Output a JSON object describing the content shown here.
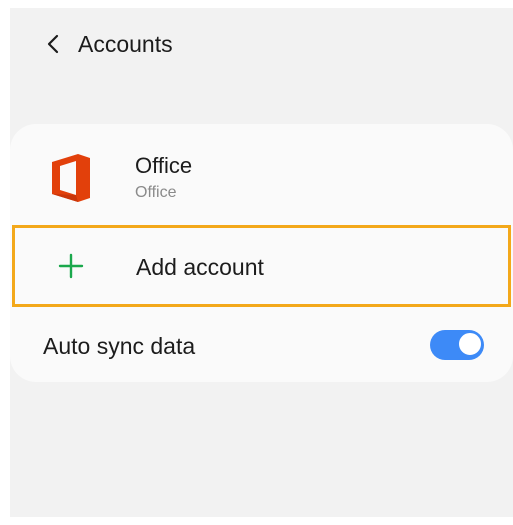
{
  "header": {
    "title": "Accounts",
    "back_icon": "chevron-left-icon"
  },
  "accounts": [
    {
      "name": "Office",
      "type": "Office",
      "icon": "office-logo"
    }
  ],
  "add_account": {
    "label": "Add account",
    "icon": "plus-icon",
    "icon_color": "#1aa84c",
    "highlight_color": "#f3a81a"
  },
  "auto_sync": {
    "label": "Auto sync data",
    "enabled": true,
    "toggle_color": "#3d8af7"
  },
  "colors": {
    "background": "#f2f2f2",
    "card": "#fafafa",
    "office_brand": "#e2400b"
  }
}
